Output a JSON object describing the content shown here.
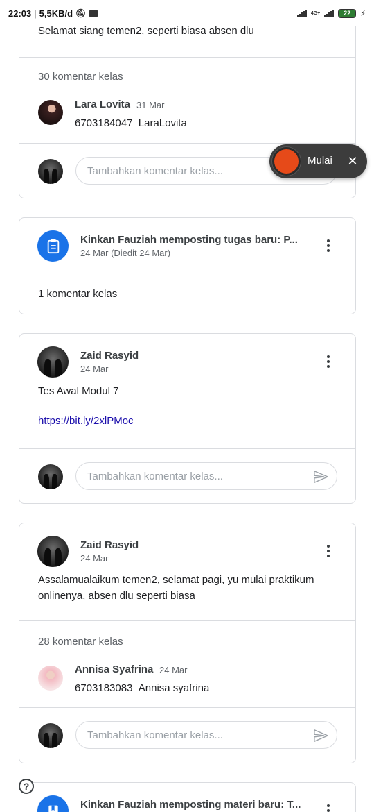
{
  "status_bar": {
    "time": "22:03",
    "speed": "5,5KB/d",
    "network": "4G+",
    "battery": "22"
  },
  "recorder": {
    "start_label": "Mulai",
    "close_label": "✕"
  },
  "comment_placeholder": "Tambahkan komentar kelas...",
  "cards": {
    "first": {
      "body": "Selamat siang temen2, seperti biasa absen dlu",
      "comment_count": "30 komentar kelas",
      "comment": {
        "author": "Lara Lovita",
        "date": "31 Mar",
        "text": "6703184047_LaraLovita"
      }
    },
    "assignment": {
      "title": "Kinkan Fauziah memposting tugas baru: P...",
      "date": "24 Mar (Diedit 24 Mar)",
      "comment_count": "1 komentar kelas"
    },
    "post_tes": {
      "author": "Zaid Rasyid",
      "date": "24 Mar",
      "body": "Tes Awal Modul 7",
      "link": "https://bit.ly/2xlPMoc"
    },
    "post_assalamualaikum": {
      "author": "Zaid Rasyid",
      "date": "24 Mar",
      "body_line1": "Assalamualaikum temen2, selamat pagi, yu mulai praktikum",
      "body_line2": "onlinenya, absen dlu seperti biasa",
      "comment_count": "28 komentar kelas",
      "comment": {
        "author": "Annisa Syafrina",
        "date": "24 Mar",
        "text": "6703183083_Annisa syafrina"
      }
    },
    "material": {
      "title": "Kinkan Fauziah memposting materi baru: T..."
    }
  },
  "help_icon": "?"
}
